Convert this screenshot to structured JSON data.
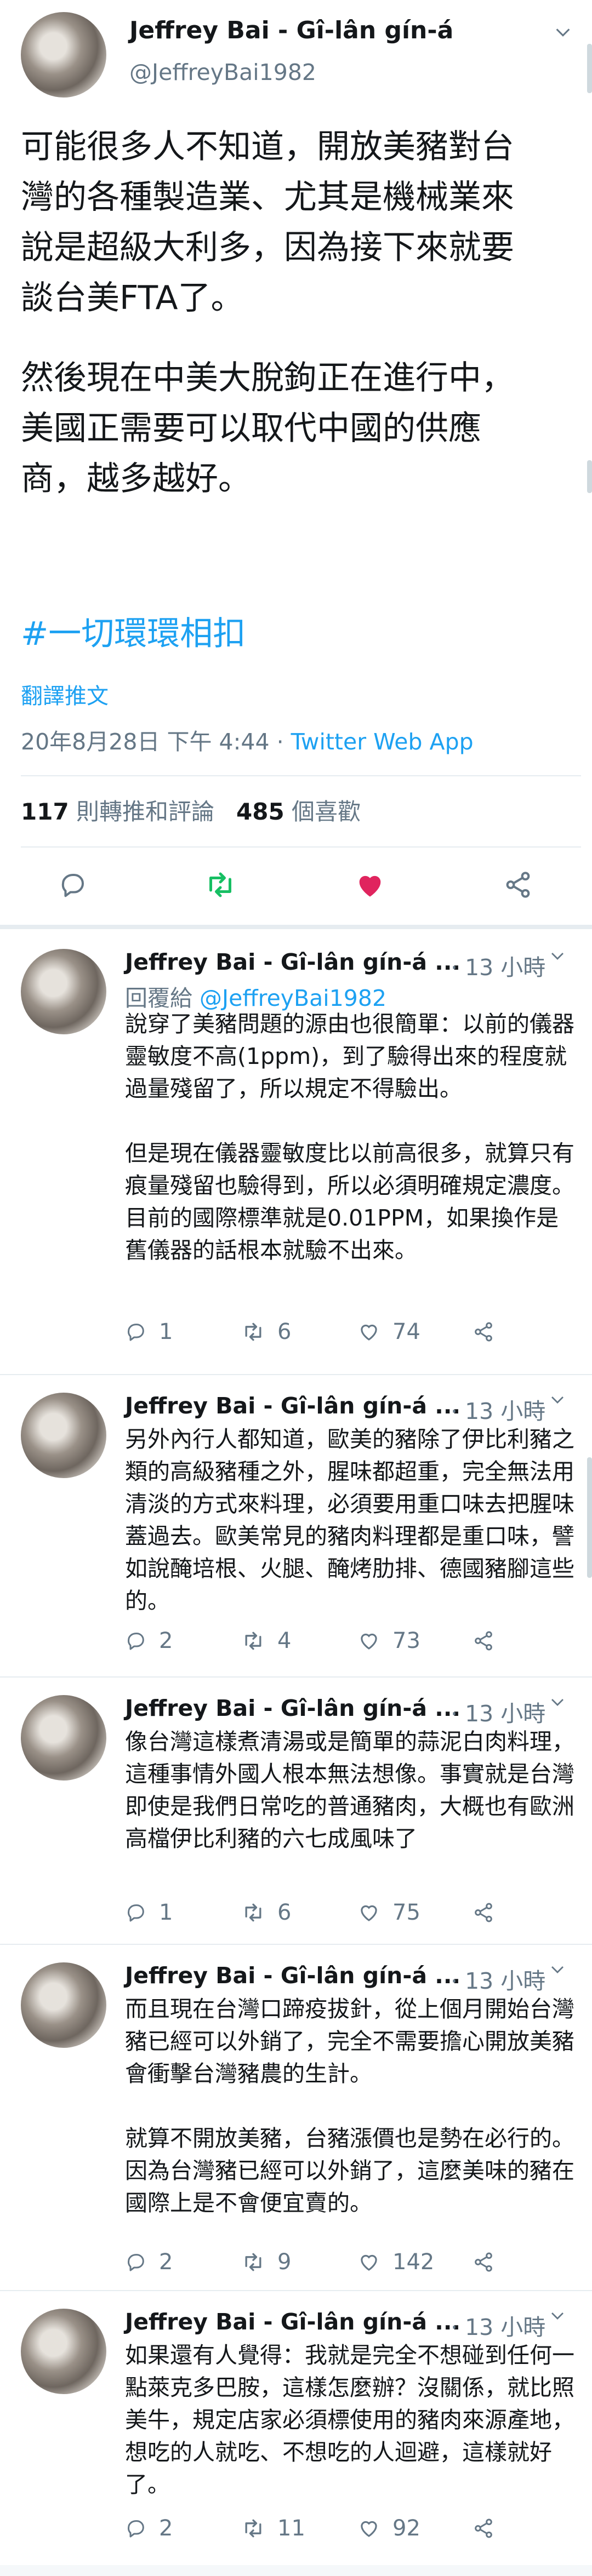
{
  "main_tweet": {
    "author_name": "Jeffrey Bai - Gî-lân gín-á",
    "author_handle": "@JeffreyBai1982",
    "paragraph1": "可能很多人不知道，開放美豬對台\n灣的各種製造業、尤其是機械業來\n說是超級大利多，因為接下來就要\n談台美FTA了。",
    "paragraph2": "然後現在中美大脫鉤正在進行中，\n美國正需要可以取代中國的供應\n商，越多越好。",
    "hashtag": "#一切環環相扣",
    "translate_label": "翻譯推文",
    "timestamp": "20年8月28日 下午 4:44",
    "separator": " · ",
    "source": "Twitter Web App",
    "retweet_count": "117",
    "retweet_label": " 則轉推和評論",
    "like_count": "485",
    "like_label": " 個喜歡"
  },
  "colors": {
    "accent": "#1da1f2",
    "retweet_green": "#17bf63",
    "like_red": "#e0245e",
    "secondary_text": "#657786"
  },
  "replies": [
    {
      "author_name": "Jeffrey Bai - Gî-lân gín-á ...",
      "time": "· 13 小時",
      "reply_to_label": "回覆給 ",
      "reply_to_handle": "@JeffreyBai1982",
      "p1": "說穿了美豬問題的源由也很簡單：以前的儀器靈敏度不高(1ppm)，到了驗得出來的程度就過量殘留了，所以規定不得驗出。",
      "p2": "但是現在儀器靈敏度比以前高很多，就算只有痕量殘留也驗得到，所以必須明確規定濃度。目前的國際標準就是0.01PPM，如果換作是舊儀器的話根本就驗不出來。",
      "reply_count": "1",
      "retweet_count": "6",
      "like_count": "74"
    },
    {
      "author_name": "Jeffrey Bai - Gî-lân gín-á ...",
      "time": "· 13 小時",
      "p1": "另外內行人都知道，歐美的豬除了伊比利豬之類的高級豬種之外，腥味都超重，完全無法用清淡的方式來料理，必須要用重口味去把腥味蓋過去。歐美常見的豬肉料理都是重口味，譬如說醃培根、火腿、醃烤肋排、德國豬腳這些的。",
      "reply_count": "2",
      "retweet_count": "4",
      "like_count": "73"
    },
    {
      "author_name": "Jeffrey Bai - Gî-lân gín-á ...",
      "time": "· 13 小時",
      "p1": "像台灣這樣煮清湯或是簡單的蒜泥白肉料理，這種事情外國人根本無法想像。事實就是台灣即使是我們日常吃的普通豬肉，大概也有歐洲高檔伊比利豬的六七成風味了",
      "reply_count": "1",
      "retweet_count": "6",
      "like_count": "75"
    },
    {
      "author_name": "Jeffrey Bai - Gî-lân gín-á ...",
      "time": "· 13 小時",
      "p1": "而且現在台灣口蹄疫拔針，從上個月開始台灣豬已經可以外銷了，完全不需要擔心開放美豬會衝擊台灣豬農的生計。",
      "p2": "就算不開放美豬，台豬漲價也是勢在必行的。因為台灣豬已經可以外銷了，這麼美味的豬在國際上是不會便宜賣的。",
      "reply_count": "2",
      "retweet_count": "9",
      "like_count": "142"
    },
    {
      "author_name": "Jeffrey Bai - Gî-lân gín-á ...",
      "time": "· 13 小時",
      "p1": "如果還有人覺得：我就是完全不想碰到任何一點萊克多巴胺，這樣怎麼辦？沒關係，就比照美牛，規定店家必須標使用的豬肉來源產地，想吃的人就吃、不想吃的人迴避，這樣就好了。",
      "reply_count": "2",
      "retweet_count": "11",
      "like_count": "92"
    }
  ]
}
